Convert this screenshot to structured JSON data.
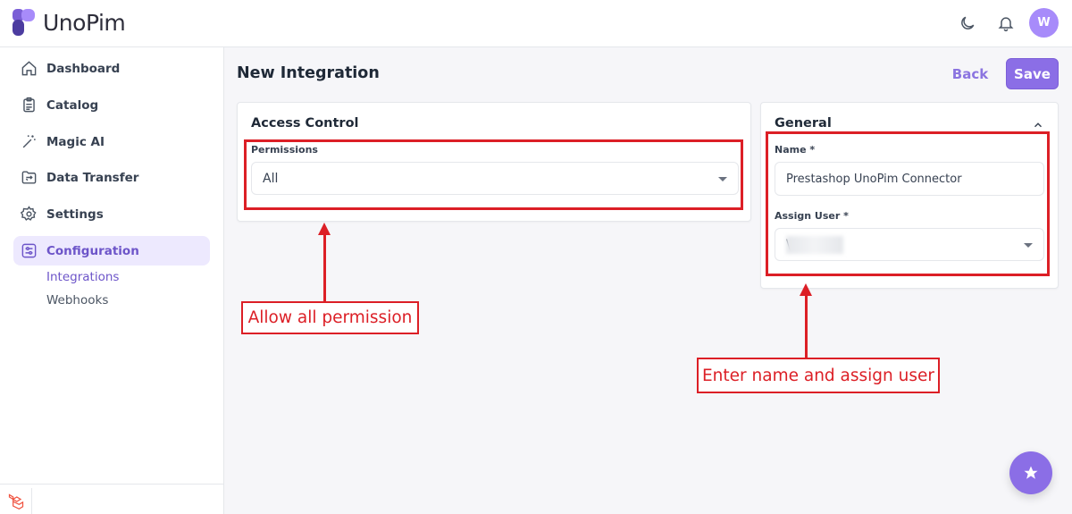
{
  "app": {
    "logo_text": "UnoPim",
    "user_initial": "W"
  },
  "header": {
    "theme_toggle_icon": "moon-icon",
    "notification_icon": "bell-icon"
  },
  "sidebar": {
    "items": [
      {
        "label": "Dashboard",
        "icon": "home-icon"
      },
      {
        "label": "Catalog",
        "icon": "clipboard-icon"
      },
      {
        "label": "Magic AI",
        "icon": "magic-wand-icon"
      },
      {
        "label": "Data Transfer",
        "icon": "folder-transfer-icon"
      },
      {
        "label": "Settings",
        "icon": "gear-icon"
      },
      {
        "label": "Configuration",
        "icon": "sliders-icon",
        "active": true
      }
    ],
    "sub_items": [
      {
        "label": "Integrations",
        "active": true
      },
      {
        "label": "Webhooks"
      }
    ]
  },
  "page": {
    "title": "New Integration",
    "back_label": "Back",
    "save_label": "Save"
  },
  "access_control": {
    "title": "Access Control",
    "permissions_label": "Permissions",
    "permissions_value": "All"
  },
  "general": {
    "title": "General",
    "name_label": "Name *",
    "name_value": "Prestashop UnoPim Connector",
    "assign_user_label": "Assign User *",
    "assign_user_value": "\\"
  },
  "annotations": {
    "left_callout": "Allow all permission",
    "right_callout": "Enter name and assign user"
  },
  "colors": {
    "accent": "#8b6ee6",
    "annotation_red": "#dc1f26"
  }
}
